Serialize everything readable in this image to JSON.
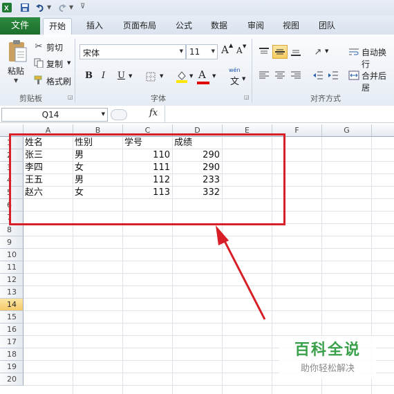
{
  "quick_access": {
    "app_icon": "excel-icon",
    "save_icon": "save-icon",
    "undo_icon": "undo-icon",
    "redo_icon": "redo-icon",
    "customize_icon": "customize-icon"
  },
  "tabs": [
    "文件",
    "开始",
    "插入",
    "页面布局",
    "公式",
    "数据",
    "审阅",
    "视图",
    "团队"
  ],
  "active_tab": "开始",
  "ribbon": {
    "clipboard": {
      "paste": "粘贴",
      "cut": "剪切",
      "copy": "复制",
      "format_painter": "格式刷",
      "group_label": "剪贴板"
    },
    "font": {
      "font_name": "宋体",
      "font_size": "11",
      "bold": "B",
      "italic": "I",
      "underline": "U",
      "grow": "A",
      "shrink": "A",
      "color_letter": "A",
      "wen": "wén",
      "wen_char": "文",
      "group_label": "字体"
    },
    "alignment": {
      "wrap_text": "自动换行",
      "merge_center": "合并后居",
      "group_label": "对齐方式"
    }
  },
  "formula_bar": {
    "name_box": "Q14",
    "fx": "fx",
    "value": ""
  },
  "sheet": {
    "columns": [
      "A",
      "B",
      "C",
      "D",
      "E",
      "F",
      "G"
    ],
    "rows": [
      "1",
      "2",
      "3",
      "4",
      "5",
      "6",
      "7",
      "8",
      "9",
      "10",
      "11",
      "12",
      "13",
      "14",
      "15",
      "16",
      "17",
      "18",
      "19",
      "20"
    ],
    "selected_row": "14",
    "data": [
      [
        "姓名",
        "性别",
        "学号",
        "成绩"
      ],
      [
        "张三",
        "男",
        "110",
        "290"
      ],
      [
        "李四",
        "女",
        "111",
        "290"
      ],
      [
        "王五",
        "男",
        "112",
        "233"
      ],
      [
        "赵六",
        "女",
        "113",
        "332"
      ]
    ]
  },
  "watermark": {
    "title": "百科全说",
    "subtitle": "助你轻松解决"
  },
  "colors": {
    "file_tab": "#1d6d2c",
    "annotation": "#d81e27",
    "watermark": "#3aa14a",
    "selected_row": "#f6c969"
  }
}
